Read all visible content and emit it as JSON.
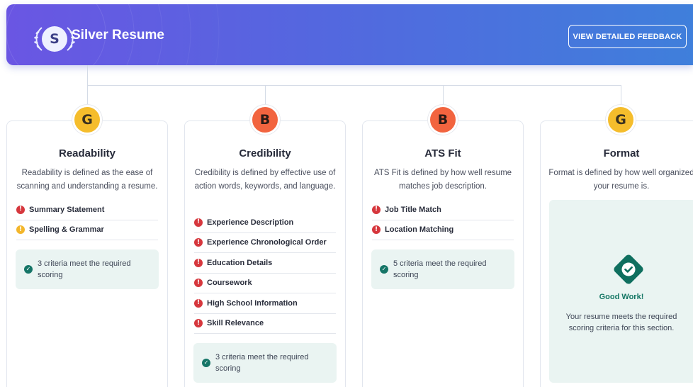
{
  "header": {
    "badge_letter": "S",
    "title": "Silver Resume",
    "feedback_button": "VIEW DETAILED FEEDBACK"
  },
  "colors": {
    "banner_start": "#6a56e3",
    "banner_end": "#3f7fdb",
    "grade_good": "#f5bd2c",
    "grade_bad": "#f2643f",
    "issue_red": "#d6373d",
    "issue_yellow": "#f3b62b",
    "success_teal": "#157567"
  },
  "cards": [
    {
      "grade": "G",
      "title": "Readability",
      "description": "Readability is defined as the ease of scanning and understanding a resume.",
      "criteria": [
        {
          "label": "Summary Statement",
          "severity": "red"
        },
        {
          "label": "Spelling & Grammar",
          "severity": "yellow"
        }
      ],
      "meet_text": "3 criteria meet the required scoring"
    },
    {
      "grade": "B",
      "title": "Credibility",
      "description": "Credibility is defined by effective use of action words, keywords, and language.",
      "criteria": [
        {
          "label": "Experience Description",
          "severity": "red"
        },
        {
          "label": "Experience Chronological Order",
          "severity": "red"
        },
        {
          "label": "Education Details",
          "severity": "red"
        },
        {
          "label": "Coursework",
          "severity": "red"
        },
        {
          "label": "High School Information",
          "severity": "red"
        },
        {
          "label": "Skill Relevance",
          "severity": "red"
        }
      ],
      "meet_text": "3 criteria meet the required scoring"
    },
    {
      "grade": "B",
      "title": "ATS Fit",
      "description": "ATS Fit is defined by how well resume matches job description.",
      "criteria": [
        {
          "label": "Job Title Match",
          "severity": "red"
        },
        {
          "label": "Location Matching",
          "severity": "red"
        }
      ],
      "meet_text": "5 criteria meet the required scoring"
    },
    {
      "grade": "G",
      "title": "Format",
      "description": "Format is defined by how well organized your resume is.",
      "good_title": "Good Work!",
      "good_text": "Your resume meets the required scoring criteria for this section."
    }
  ]
}
